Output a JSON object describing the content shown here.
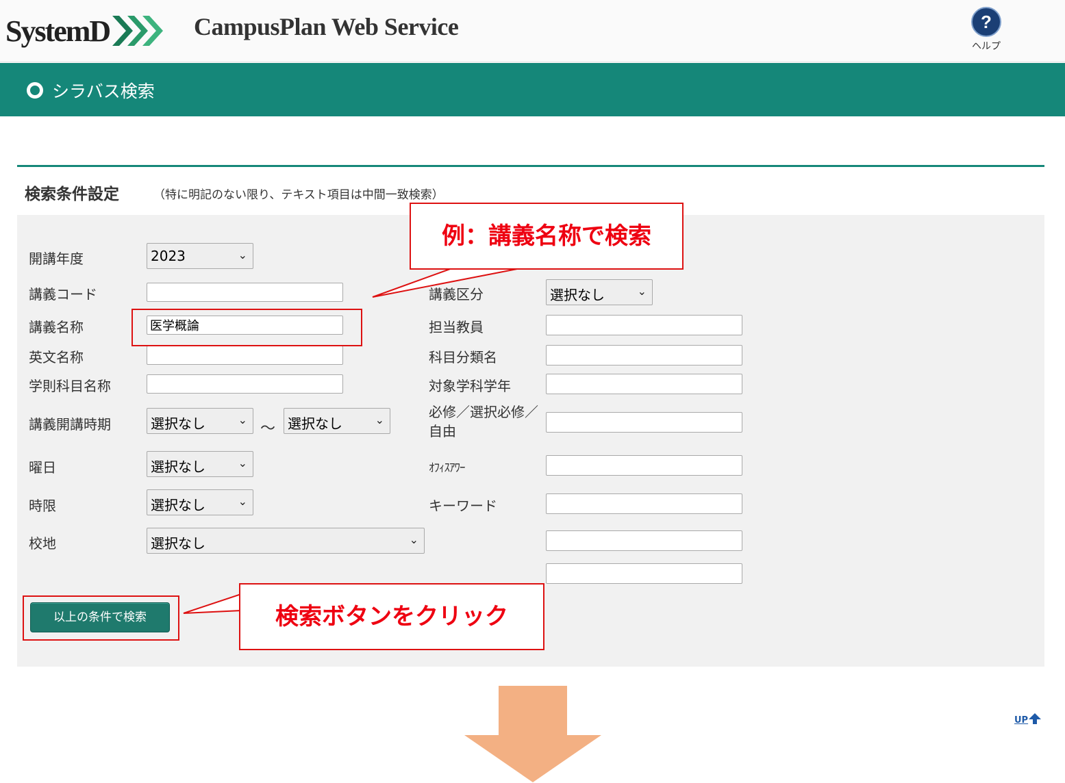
{
  "header": {
    "logo_text": "SystemD",
    "app_title": "CampusPlan Web Service",
    "help_glyph": "?",
    "help_label": "ヘルプ"
  },
  "page": {
    "title": "シラバス検索"
  },
  "section": {
    "title": "検索条件設定",
    "note": "（特に明記のない限り、テキスト項目は中間一致検索）"
  },
  "form": {
    "year": {
      "label": "開講年度",
      "value": "2023"
    },
    "course_code": {
      "label": "講義コード",
      "value": ""
    },
    "course_name": {
      "label": "講義名称",
      "value": "医学概論"
    },
    "english_name": {
      "label": "英文名称",
      "value": ""
    },
    "academic_subject": {
      "label": "学則科目名称",
      "value": ""
    },
    "period": {
      "label": "講義開講時期",
      "from": "選択なし",
      "to": "選択なし",
      "separator": "～"
    },
    "weekday": {
      "label": "曜日",
      "value": "選択なし"
    },
    "time_slot": {
      "label": "時限",
      "value": "選択なし"
    },
    "campus": {
      "label": "校地",
      "value": "選択なし"
    },
    "course_type": {
      "label": "講義区分",
      "value": "選択なし"
    },
    "instructor": {
      "label": "担当教員",
      "value": ""
    },
    "category": {
      "label": "科目分類名",
      "value": ""
    },
    "target_dept": {
      "label": "対象学科学年",
      "value": ""
    },
    "required": {
      "label": "必修／選択必修／自由",
      "value": ""
    },
    "office_hour": {
      "label": "ｵﾌｨｽｱﾜｰ",
      "value": ""
    },
    "keyword": {
      "label": "キーワード",
      "value": ""
    },
    "extra1": {
      "value": ""
    },
    "extra2": {
      "value": ""
    },
    "search_button": "以上の条件で検索"
  },
  "callouts": {
    "example": "例：講義名称で検索",
    "click": "検索ボタンをクリック"
  },
  "up_link": "UP",
  "colors": {
    "brand_teal": "#158779",
    "button_teal": "#1f7a6d",
    "callout_red": "#dd1111",
    "arrow_orange": "#f3b083",
    "panel_gray": "#f1f1f1"
  }
}
